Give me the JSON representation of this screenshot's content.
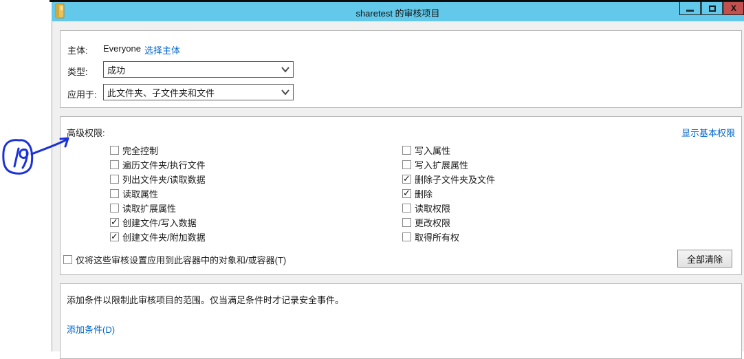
{
  "window": {
    "title": "sharetest 的审核项目",
    "controls": {
      "minimize": "minimize",
      "maximize": "maximize",
      "close": "x"
    }
  },
  "principal": {
    "label": "主体:",
    "value": "Everyone",
    "link": "选择主体"
  },
  "type_field": {
    "label": "类型:",
    "value": "成功"
  },
  "applies_field": {
    "label": "应用于:",
    "value": "此文件夹、子文件夹和文件"
  },
  "permissions": {
    "heading": "高级权限:",
    "toggle_link": "显示基本权限",
    "left": [
      {
        "label": "完全控制",
        "checked": false
      },
      {
        "label": "遍历文件夹/执行文件",
        "checked": false
      },
      {
        "label": "列出文件夹/读取数据",
        "checked": false
      },
      {
        "label": "读取属性",
        "checked": false
      },
      {
        "label": "读取扩展属性",
        "checked": false
      },
      {
        "label": "创建文件/写入数据",
        "checked": true
      },
      {
        "label": "创建文件夹/附加数据",
        "checked": true
      }
    ],
    "right": [
      {
        "label": "写入属性",
        "checked": false
      },
      {
        "label": "写入扩展属性",
        "checked": false
      },
      {
        "label": "删除子文件夹及文件",
        "checked": true
      },
      {
        "label": "删除",
        "checked": true
      },
      {
        "label": "读取权限",
        "checked": false
      },
      {
        "label": "更改权限",
        "checked": false
      },
      {
        "label": "取得所有权",
        "checked": false
      }
    ],
    "scope_checkbox": {
      "label": "仅将这些审核设置应用到此容器中的对象和/或容器(T)",
      "checked": false
    },
    "clear_all_label": "全部清除"
  },
  "condition": {
    "description": "添加条件以限制此审核项目的范围。仅当满足条件时才记录安全事件。",
    "add_link": "添加条件(D)"
  },
  "annotation": {
    "text": "19"
  },
  "colors": {
    "titlebar": "#63c9ea",
    "close_button": "#c0514f",
    "link": "#0066cc",
    "ink": "#1c32d9",
    "body": "#f0f0f0"
  }
}
